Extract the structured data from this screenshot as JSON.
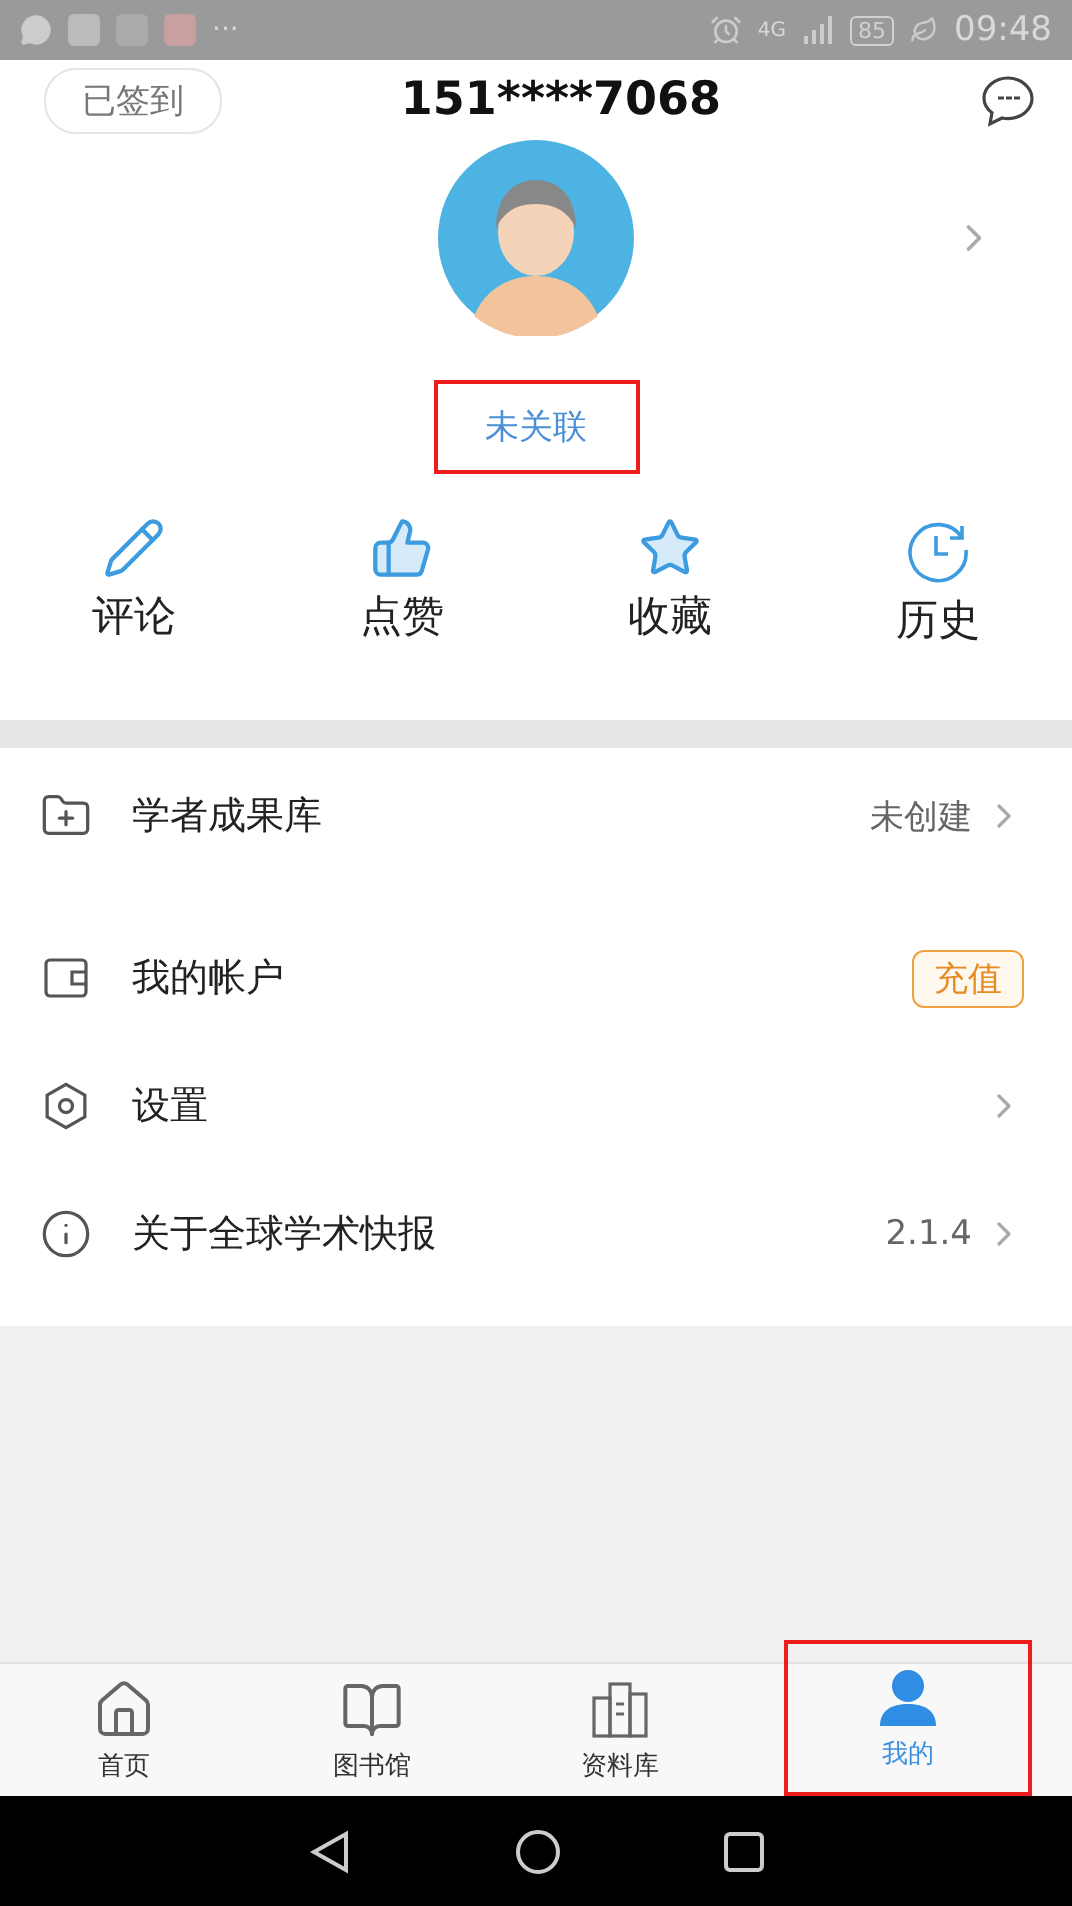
{
  "status_bar": {
    "more": "···",
    "network": "4G",
    "battery": "85",
    "time": "09:48"
  },
  "header": {
    "checkin": "已签到",
    "title": "151****7068"
  },
  "profile": {
    "link": "未关联",
    "highlighted": true
  },
  "actions": [
    {
      "kind": "comment",
      "label": "评论"
    },
    {
      "kind": "like",
      "label": "点赞"
    },
    {
      "kind": "favorite",
      "label": "收藏"
    },
    {
      "kind": "history",
      "label": "历史"
    }
  ],
  "menu": [
    {
      "kind": "folder",
      "label": "学者成果库",
      "value": "未创建"
    },
    {
      "kind": "wallet",
      "label": "我的帐户",
      "button": "充值"
    },
    {
      "kind": "settings",
      "label": "设置"
    },
    {
      "kind": "info",
      "label": "关于全球学术快报",
      "value": "2.1.4"
    }
  ],
  "tabs": [
    {
      "kind": "home",
      "label": "首页",
      "selected": false,
      "highlighted": false
    },
    {
      "kind": "book",
      "label": "图书馆",
      "selected": false,
      "highlighted": false
    },
    {
      "kind": "building",
      "label": "资料库",
      "selected": false,
      "highlighted": false
    },
    {
      "kind": "user",
      "label": "我的",
      "selected": true,
      "highlighted": true
    }
  ]
}
